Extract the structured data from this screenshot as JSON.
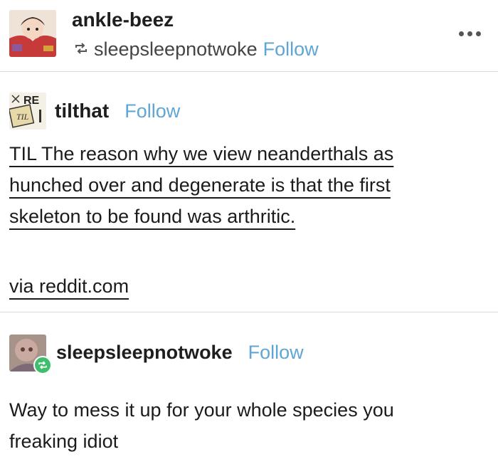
{
  "post": {
    "poster": "ankle-beez",
    "reblogged_from": "sleepsleepnotwoke",
    "follow_label": "Follow",
    "more_menu_icon": "ellipsis-icon"
  },
  "original": {
    "username": "tilthat",
    "follow_label": "Follow",
    "lines": [
      "TIL The reason why we view neanderthals as",
      "hunched over and degenerate is that the first",
      "skeleton to be found was arthritic."
    ],
    "via": "via reddit.com",
    "avatar_text": "RE"
  },
  "reply": {
    "username": "sleepsleepnotwoke",
    "follow_label": "Follow",
    "lines": [
      "Way to mess it up for your whole species you",
      "freaking idiot"
    ]
  },
  "colors": {
    "follow": "#5fa6d6",
    "divider": "#d9d9d9",
    "reblog_badge": "#3fbf6e"
  }
}
